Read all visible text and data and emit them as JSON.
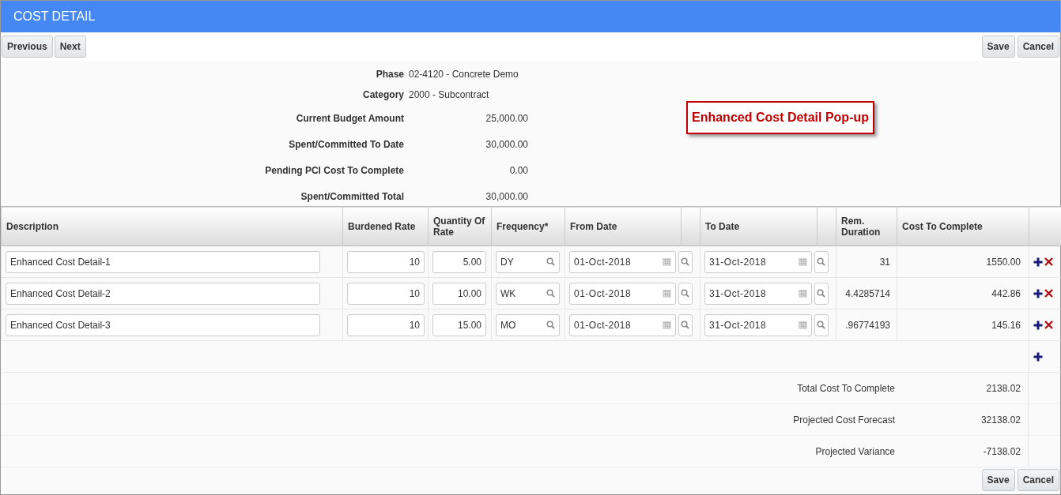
{
  "window": {
    "title": "COST DETAIL"
  },
  "nav_buttons": [
    "Previous",
    "Next"
  ],
  "action_buttons": [
    "Save",
    "Cancel"
  ],
  "summary": [
    {
      "label": "Phase",
      "value": "02-4120 - Concrete Demo",
      "kind": "text"
    },
    {
      "label": "Category",
      "value": "2000 - Subcontract",
      "kind": "text"
    },
    {
      "label": "Current Budget Amount",
      "value": "25,000.00",
      "kind": "amount"
    },
    {
      "label": "Spent/Committed To Date",
      "value": "30,000.00",
      "kind": "amount"
    },
    {
      "label": "Pending PCI Cost To Complete",
      "value": "0.00",
      "kind": "amount"
    },
    {
      "label": "Spent/Committed Total",
      "value": "30,000.00",
      "kind": "amount"
    }
  ],
  "callout": "Enhanced Cost Detail Pop-up",
  "table": {
    "columns": [
      "Description",
      "Burdened Rate",
      "Quantity Of Rate",
      "Frequency*",
      "From Date",
      "To Date",
      "Rem. Duration",
      "Cost To Complete"
    ],
    "rows": [
      {
        "description": "Enhanced Cost Detail-1",
        "burdened_rate": "10",
        "quantity": "5.00",
        "frequency": "DY",
        "from_date": "01-Oct-2018",
        "to_date": "31-Oct-2018",
        "rem_duration": "31",
        "cost_to_complete": "1550.00"
      },
      {
        "description": "Enhanced Cost Detail-2",
        "burdened_rate": "10",
        "quantity": "10.00",
        "frequency": "WK",
        "from_date": "01-Oct-2018",
        "to_date": "31-Oct-2018",
        "rem_duration": "4.4285714",
        "cost_to_complete": "442.86"
      },
      {
        "description": "Enhanced Cost Detail-3",
        "burdened_rate": "10",
        "quantity": "15.00",
        "frequency": "MO",
        "from_date": "01-Oct-2018",
        "to_date": "31-Oct-2018",
        "rem_duration": ".96774193",
        "cost_to_complete": "145.16"
      }
    ]
  },
  "totals": [
    {
      "label": "Total Cost To Complete",
      "value": "2138.02"
    },
    {
      "label": "Projected Cost Forecast",
      "value": "32138.02"
    },
    {
      "label": "Projected Variance",
      "value": "-7138.02"
    }
  ],
  "footer_buttons": [
    "Save",
    "Cancel"
  ]
}
